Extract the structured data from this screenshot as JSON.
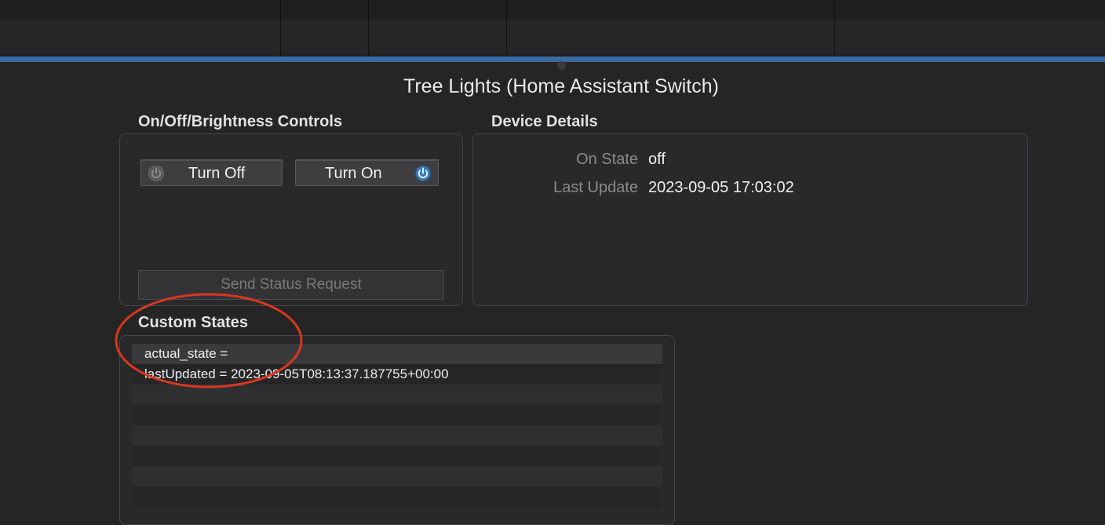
{
  "device": {
    "title": "Tree Lights (Home Assistant Switch)"
  },
  "controls": {
    "group_label": "On/Off/Brightness Controls",
    "turn_off_label": "Turn Off",
    "turn_on_label": "Turn On",
    "send_status_label": "Send Status Request"
  },
  "details": {
    "group_label": "Device Details",
    "rows": [
      {
        "label": "On State",
        "value": "off"
      },
      {
        "label": "Last Update",
        "value": "2023-09-05 17:03:02"
      }
    ]
  },
  "custom_states": {
    "group_label": "Custom States",
    "rows": [
      "actual_state =",
      "lastUpdated = 2023-09-05T08:13:37.187755+00:00",
      "",
      "",
      "",
      "",
      "",
      ""
    ]
  },
  "icons": {
    "turn_off_icon": "power-icon",
    "turn_on_icon": "power-icon"
  },
  "colors": {
    "selection": "#3b6aa0",
    "annotation": "#d9371e",
    "power_on": "#7fb6ea",
    "power_off": "#8a8a8a"
  }
}
